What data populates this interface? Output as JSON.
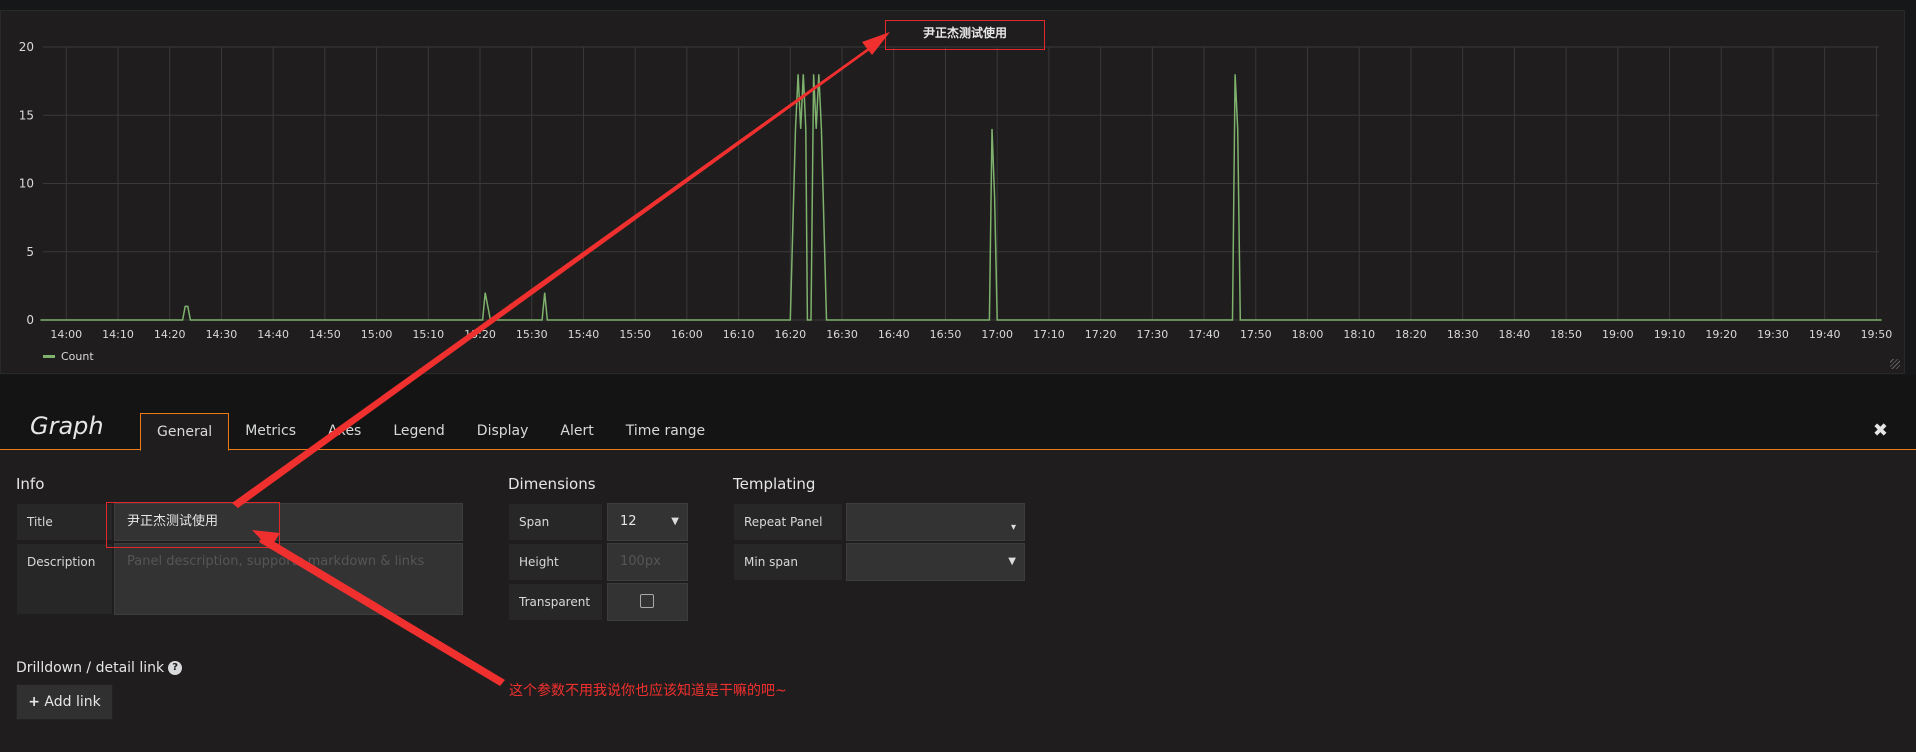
{
  "graph_panel": {
    "title": "尹正杰测试使用",
    "legend": {
      "label": "Count"
    }
  },
  "chart_data": {
    "type": "line",
    "title": "尹正杰测试使用",
    "y_ticks": [
      "0",
      "5",
      "10",
      "15",
      "20"
    ],
    "ylim": [
      0,
      20
    ],
    "x_ticks": [
      "14:00",
      "14:10",
      "14:20",
      "14:30",
      "14:40",
      "14:50",
      "15:00",
      "15:10",
      "15:20",
      "15:30",
      "15:40",
      "15:50",
      "16:00",
      "16:10",
      "16:20",
      "16:30",
      "16:40",
      "16:50",
      "17:00",
      "17:10",
      "17:20",
      "17:30",
      "17:40",
      "17:50",
      "18:00",
      "18:10",
      "18:20",
      "18:30",
      "18:40",
      "18:50",
      "19:00",
      "19:10",
      "19:20",
      "19:30",
      "19:40",
      "19:50"
    ],
    "x_range_minutes": [
      835.5,
      1190.5
    ],
    "grid": true,
    "legend_position": "bottom-left",
    "series": [
      {
        "name": "Count",
        "color": "#7eb26d",
        "points": [
          [
            "13:55",
            0
          ],
          [
            "14:22.5",
            0
          ],
          [
            "14:23",
            1
          ],
          [
            "14:23.5",
            1
          ],
          [
            "14:24",
            0
          ],
          [
            "15:20.5",
            0
          ],
          [
            "15:21",
            2
          ],
          [
            "15:22",
            0
          ],
          [
            "15:32",
            0
          ],
          [
            "15:32.5",
            2
          ],
          [
            "15:33",
            0
          ],
          [
            "16:20",
            0
          ],
          [
            "16:21",
            14
          ],
          [
            "16:21.5",
            18
          ],
          [
            "16:22",
            14
          ],
          [
            "16:22.5",
            18
          ],
          [
            "16:23",
            14
          ],
          [
            "16:23.3",
            0
          ],
          [
            "16:24",
            0
          ],
          [
            "16:24.5",
            18
          ],
          [
            "16:25",
            14
          ],
          [
            "16:25.5",
            18
          ],
          [
            "16:26",
            14
          ],
          [
            "16:27",
            0
          ],
          [
            "16:58.5",
            0
          ],
          [
            "16:59",
            14
          ],
          [
            "16:59.5",
            9
          ],
          [
            "17:00",
            0
          ],
          [
            "17:45.5",
            0
          ],
          [
            "17:46",
            18
          ],
          [
            "17:46.5",
            14
          ],
          [
            "17:47",
            0
          ],
          [
            "19:51",
            0
          ]
        ]
      }
    ]
  },
  "editor": {
    "panel_type": "Graph",
    "tabs": [
      "General",
      "Metrics",
      "Axes",
      "Legend",
      "Display",
      "Alert",
      "Time range"
    ],
    "active_tab": "General",
    "close_icon": "times-icon",
    "info": {
      "heading": "Info",
      "title_label": "Title",
      "title_value": "尹正杰测试使用",
      "description_label": "Description",
      "description_placeholder": "Panel description, supports markdown & links"
    },
    "dimensions": {
      "heading": "Dimensions",
      "span_label": "Span",
      "span_value": "12",
      "height_label": "Height",
      "height_placeholder": "100px",
      "transparent_label": "Transparent",
      "transparent_checked": false
    },
    "templating": {
      "heading": "Templating",
      "repeat_label": "Repeat Panel",
      "repeat_value": "",
      "min_span_label": "Min span",
      "min_span_value": ""
    },
    "drilldown": {
      "heading": "Drilldown / detail link",
      "help_icon": "question-circle-icon",
      "add_link_label": "Add link"
    }
  },
  "annotation": {
    "text": "这个参数不用我说你也应该知道是干嘛的吧~",
    "color": "#f0302f"
  }
}
